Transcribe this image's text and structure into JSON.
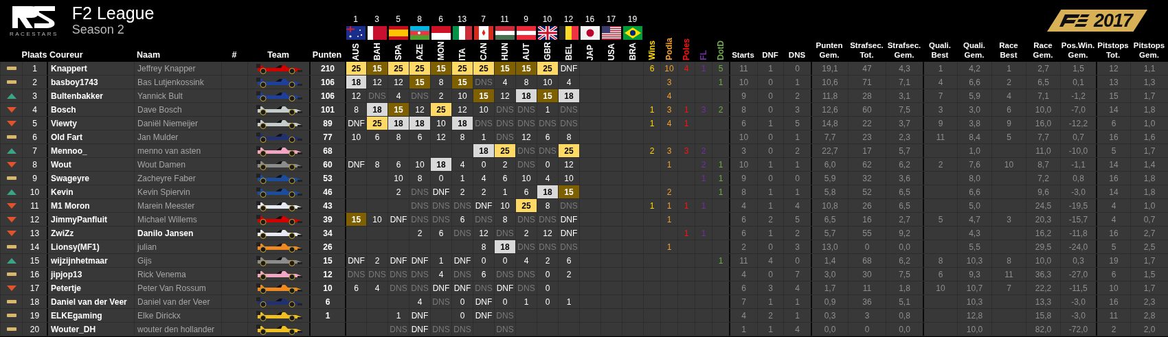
{
  "league": {
    "logo_text": "RACESTARS",
    "title": "F2 League",
    "subtitle": "Season 2",
    "game_year": "2017"
  },
  "columns": [
    "Plaats",
    "Coureur",
    "Naam",
    "#",
    "Team",
    "Punten"
  ],
  "races": [
    {
      "round": "1",
      "code": "AUS"
    },
    {
      "round": "3",
      "code": "BAH"
    },
    {
      "round": "5",
      "code": "SPA"
    },
    {
      "round": "8",
      "code": "AZE"
    },
    {
      "round": "6",
      "code": "MON"
    },
    {
      "round": "13",
      "code": "ITA"
    },
    {
      "round": "7",
      "code": "CAN"
    },
    {
      "round": "11",
      "code": "HUN"
    },
    {
      "round": "9",
      "code": "AUT"
    },
    {
      "round": "10",
      "code": "GBR"
    },
    {
      "round": "12",
      "code": "BEL"
    },
    {
      "round": "16",
      "code": "JAP"
    },
    {
      "round": "17",
      "code": "USA"
    },
    {
      "round": "19",
      "code": "BRA"
    }
  ],
  "stat_columns": [
    {
      "label": "Wins",
      "color": "#ffd800"
    },
    {
      "label": "Podia",
      "color": "#f0a030"
    },
    {
      "label": "Poles",
      "color": "#ff1010"
    },
    {
      "label": "FL",
      "color": "#7030a0"
    },
    {
      "label": "DotD",
      "color": "#70ad47"
    }
  ],
  "summary_columns": [
    "Starts",
    "DNF",
    "DNS",
    "Punten\nGem.",
    "Strafsec.\nTot.",
    "Strafsec.\nGem.",
    "Quali.\nBest",
    "Quali.\nGem.",
    "Race\nBest",
    "Race\nGem.",
    "Pos.Win.\nGem.",
    "Pitstops\nTot.",
    "Pitstops\nGem."
  ],
  "rows": [
    {
      "moved_up": false,
      "moved_down": false,
      "place": "1",
      "driver": "Knappert",
      "name": "Jeffrey Knapper",
      "name_bold": false,
      "team": {
        "color": "#d40000"
      },
      "points": "210",
      "results": [
        {
          "t": "25",
          "kind": "first"
        },
        {
          "t": "15",
          "kind": "third"
        },
        {
          "t": "25",
          "kind": "first"
        },
        {
          "t": "25",
          "kind": "first"
        },
        {
          "t": "15",
          "kind": "third"
        },
        {
          "t": "25",
          "kind": "first"
        },
        {
          "t": "25",
          "kind": "first"
        },
        {
          "t": "15",
          "kind": "third"
        },
        {
          "t": "15",
          "kind": "third"
        },
        {
          "t": "25",
          "kind": "first"
        },
        {
          "t": "DNF",
          "kind": "plain"
        },
        {
          "kind": "empty"
        },
        {
          "kind": "empty"
        },
        {
          "kind": "empty"
        }
      ],
      "wins": "6",
      "podia": "10",
      "poles": "4",
      "fl": "1",
      "dotd": "5",
      "starts": "11",
      "dnf": "1",
      "dns": "0",
      "points_avg": "19,1",
      "penalty_total": "47",
      "penalty_avg": "4,3",
      "quali_best": "1",
      "quali_avg": "4,2",
      "race_best": "1",
      "race_avg": "2,7",
      "pos_gain_avg": "1,5",
      "pitstops_total": "12",
      "pitstops_avg": "1,1"
    },
    {
      "moved_up": false,
      "moved_down": false,
      "place": "2",
      "driver": "basboy1743",
      "name": "Bas Lutjenkossink",
      "name_bold": false,
      "team": {
        "color": "#1d3f9e"
      },
      "points": "106",
      "results": [
        {
          "t": "18",
          "kind": "second"
        },
        {
          "t": "12",
          "kind": "plain"
        },
        {
          "t": "12",
          "kind": "plain"
        },
        {
          "t": "15",
          "kind": "third"
        },
        {
          "t": "8",
          "kind": "plain"
        },
        {
          "t": "15",
          "kind": "third"
        },
        {
          "t": "DNS",
          "kind": "dns"
        },
        {
          "t": "4",
          "kind": "plain"
        },
        {
          "t": "8",
          "kind": "plain"
        },
        {
          "t": "10",
          "kind": "plain"
        },
        {
          "t": "4",
          "kind": "plain"
        },
        {
          "kind": "empty"
        },
        {
          "kind": "empty"
        },
        {
          "kind": "empty"
        }
      ],
      "podia": "3",
      "dotd": "1",
      "starts": "10",
      "dnf": "0",
      "dns": "1",
      "points_avg": "10,6",
      "penalty_total": "71",
      "penalty_avg": "7,1",
      "quali_best": "4",
      "quali_avg": "6,6",
      "race_best": "2",
      "race_avg": "6,5",
      "pos_gain_avg": "0,1",
      "pitstops_total": "13",
      "pitstops_avg": "1,3"
    },
    {
      "moved_up": true,
      "moved_down": false,
      "place": "3",
      "driver": "Bultenbakker",
      "name": "Yannick Bult",
      "name_bold": false,
      "team": {
        "color": "#1d3f9e"
      },
      "points": "106",
      "results": [
        {
          "t": "12",
          "kind": "plain"
        },
        {
          "t": "DNS",
          "kind": "dns"
        },
        {
          "t": "4",
          "kind": "plain"
        },
        {
          "t": "DNS",
          "kind": "dns"
        },
        {
          "t": "2",
          "kind": "plain"
        },
        {
          "t": "10",
          "kind": "plain"
        },
        {
          "t": "15",
          "kind": "third"
        },
        {
          "t": "12",
          "kind": "plain"
        },
        {
          "t": "18",
          "kind": "second"
        },
        {
          "t": "15",
          "kind": "third"
        },
        {
          "t": "18",
          "kind": "second"
        },
        {
          "kind": "empty"
        },
        {
          "kind": "empty"
        },
        {
          "kind": "empty"
        }
      ],
      "podia": "4",
      "starts": "9",
      "dnf": "0",
      "dns": "2",
      "points_avg": "11,8",
      "penalty_total": "28",
      "penalty_avg": "3,1",
      "quali_best": "7",
      "quali_avg": "5,9",
      "race_best": "4",
      "race_avg": "7,1",
      "pos_gain_avg": "-1,2",
      "pitstops_total": "15",
      "pitstops_avg": "1,7"
    },
    {
      "moved_up": false,
      "moved_down": true,
      "place": "4",
      "driver": "Bosch",
      "name": "Dave Bosch",
      "name_bold": false,
      "team": {
        "color": "#c4cccc"
      },
      "points": "101",
      "results": [
        {
          "t": "8",
          "kind": "plain"
        },
        {
          "t": "18",
          "kind": "second"
        },
        {
          "t": "15",
          "kind": "third"
        },
        {
          "t": "12",
          "kind": "plain"
        },
        {
          "t": "25",
          "kind": "first"
        },
        {
          "t": "12",
          "kind": "plain"
        },
        {
          "t": "10",
          "kind": "plain"
        },
        {
          "t": "DNS",
          "kind": "dns"
        },
        {
          "t": "DNS",
          "kind": "dns"
        },
        {
          "t": "1",
          "kind": "plain"
        },
        {
          "t": "DNS",
          "kind": "dns"
        },
        {
          "kind": "empty"
        },
        {
          "kind": "empty"
        },
        {
          "kind": "empty"
        }
      ],
      "wins": "1",
      "podia": "3",
      "poles": "1",
      "fl": "3",
      "dotd": "2",
      "starts": "8",
      "dnf": "0",
      "dns": "3",
      "points_avg": "12,6",
      "penalty_total": "60",
      "penalty_avg": "7,5",
      "quali_best": "3",
      "quali_avg": "3,0",
      "race_best": "6",
      "race_avg": "10,0",
      "pos_gain_avg": "-7,0",
      "pitstops_total": "14",
      "pitstops_avg": "1,8"
    },
    {
      "moved_up": false,
      "moved_down": true,
      "place": "5",
      "driver": "Viewty",
      "name": "Daniël Niemeijer",
      "name_bold": false,
      "team": {
        "color": "#c4cccc"
      },
      "points": "89",
      "results": [
        {
          "t": "DNF",
          "kind": "plain"
        },
        {
          "t": "25",
          "kind": "first"
        },
        {
          "t": "18",
          "kind": "second"
        },
        {
          "t": "18",
          "kind": "second"
        },
        {
          "t": "10",
          "kind": "plain"
        },
        {
          "t": "18",
          "kind": "second"
        },
        {
          "t": "DNS",
          "kind": "dns"
        },
        {
          "t": "DNS",
          "kind": "dns"
        },
        {
          "t": "DNS",
          "kind": "dns"
        },
        {
          "t": "DNS",
          "kind": "dns"
        },
        {
          "t": "DNS",
          "kind": "dns"
        },
        {
          "kind": "empty"
        },
        {
          "kind": "empty"
        },
        {
          "kind": "empty"
        }
      ],
      "wins": "1",
      "podia": "4",
      "poles": "1",
      "starts": "6",
      "dnf": "1",
      "dns": "5",
      "points_avg": "14,8",
      "penalty_total": "22",
      "penalty_avg": "3,7",
      "quali_best": "9",
      "quali_avg": "3,8",
      "race_best": "9",
      "race_avg": "16,0",
      "pos_gain_avg": "-12,2",
      "pitstops_total": "6",
      "pitstops_avg": "1,0"
    },
    {
      "moved_up": false,
      "moved_down": false,
      "place": "6",
      "driver": "Old Fart",
      "name": "Jan Mulder",
      "name_bold": false,
      "team": {
        "color": "#223070"
      },
      "points": "77",
      "results": [
        {
          "t": "10",
          "kind": "plain"
        },
        {
          "t": "6",
          "kind": "plain"
        },
        {
          "t": "8",
          "kind": "plain"
        },
        {
          "t": "6",
          "kind": "plain"
        },
        {
          "t": "12",
          "kind": "plain"
        },
        {
          "t": "8",
          "kind": "plain"
        },
        {
          "t": "1",
          "kind": "plain"
        },
        {
          "t": "DNS",
          "kind": "dns"
        },
        {
          "t": "12",
          "kind": "plain"
        },
        {
          "t": "6",
          "kind": "plain"
        },
        {
          "t": "8",
          "kind": "plain"
        },
        {
          "kind": "empty"
        },
        {
          "kind": "empty"
        },
        {
          "kind": "empty"
        }
      ],
      "starts": "10",
      "dnf": "0",
      "dns": "1",
      "points_avg": "7,7",
      "penalty_total": "23",
      "penalty_avg": "2,3",
      "quali_best": "11",
      "quali_avg": "8,4",
      "race_best": "5",
      "race_avg": "7,7",
      "pos_gain_avg": "0,7",
      "pitstops_total": "16",
      "pitstops_avg": "1,6"
    },
    {
      "moved_up": true,
      "moved_down": false,
      "place": "7",
      "driver": "Mennoo_",
      "name": "menno van asten",
      "name_bold": false,
      "team": {
        "color": "#f2a6c4"
      },
      "points": "68",
      "results": [
        {
          "kind": "empty"
        },
        {
          "kind": "empty"
        },
        {
          "kind": "empty"
        },
        {
          "kind": "empty"
        },
        {
          "kind": "empty"
        },
        {
          "kind": "empty"
        },
        {
          "t": "18",
          "kind": "second"
        },
        {
          "t": "25",
          "kind": "first"
        },
        {
          "t": "DNS",
          "kind": "dns"
        },
        {
          "t": "DNS",
          "kind": "dns"
        },
        {
          "t": "25",
          "kind": "first"
        },
        {
          "kind": "empty"
        },
        {
          "kind": "empty"
        },
        {
          "kind": "empty"
        }
      ],
      "wins": "2",
      "podia": "3",
      "poles": "3",
      "fl": "2",
      "starts": "3",
      "dnf": "0",
      "dns": "2",
      "points_avg": "22,7",
      "penalty_total": "17",
      "penalty_avg": "5,7",
      "quali_avg": "1,0",
      "race_avg": "11,0",
      "pos_gain_avg": "-10,0",
      "pitstops_total": "5",
      "pitstops_avg": "1,7"
    },
    {
      "moved_up": false,
      "moved_down": true,
      "place": "8",
      "driver": "Wout",
      "name": "Wout Damen",
      "name_bold": false,
      "team": {
        "color": "#8c8c8c"
      },
      "points": "60",
      "results": [
        {
          "t": "DNF",
          "kind": "plain"
        },
        {
          "t": "8",
          "kind": "plain"
        },
        {
          "t": "6",
          "kind": "plain"
        },
        {
          "t": "10",
          "kind": "plain"
        },
        {
          "t": "18",
          "kind": "second"
        },
        {
          "t": "4",
          "kind": "plain"
        },
        {
          "t": "0",
          "kind": "plain"
        },
        {
          "t": "2",
          "kind": "plain"
        },
        {
          "t": "DNS",
          "kind": "dns"
        },
        {
          "t": "0",
          "kind": "plain"
        },
        {
          "t": "12",
          "kind": "plain"
        },
        {
          "kind": "empty"
        },
        {
          "kind": "empty"
        },
        {
          "kind": "empty"
        }
      ],
      "podia": "1",
      "fl": "2",
      "dotd": "1",
      "starts": "10",
      "dnf": "1",
      "dns": "1",
      "points_avg": "6,0",
      "penalty_total": "62",
      "penalty_avg": "6,2",
      "quali_best": "2",
      "quali_avg": "7,6",
      "race_best": "10",
      "race_avg": "8,7",
      "pos_gain_avg": "-1,1",
      "pitstops_total": "14",
      "pitstops_avg": "1,4"
    },
    {
      "moved_up": false,
      "moved_down": false,
      "place": "9",
      "driver": "Swageyre",
      "name": "Zacheyre Faber",
      "name_bold": false,
      "team": {
        "color": "#1c4c9c"
      },
      "points": "53",
      "results": [
        {
          "kind": "empty"
        },
        {
          "kind": "empty"
        },
        {
          "t": "10",
          "kind": "plain"
        },
        {
          "t": "8",
          "kind": "plain"
        },
        {
          "t": "0",
          "kind": "plain"
        },
        {
          "t": "1",
          "kind": "plain"
        },
        {
          "t": "4",
          "kind": "plain"
        },
        {
          "t": "6",
          "kind": "plain"
        },
        {
          "t": "10",
          "kind": "plain"
        },
        {
          "t": "4",
          "kind": "plain"
        },
        {
          "t": "10",
          "kind": "plain"
        },
        {
          "kind": "empty"
        },
        {
          "kind": "empty"
        },
        {
          "kind": "empty"
        }
      ],
      "fl": "1",
      "dotd": "1",
      "starts": "9",
      "dnf": "0",
      "dns": "0",
      "points_avg": "5,9",
      "penalty_total": "32",
      "penalty_avg": "3,6",
      "quali_avg": "8,0",
      "race_avg": "7,2",
      "pos_gain_avg": "0,8",
      "pitstops_total": "16",
      "pitstops_avg": "1,8"
    },
    {
      "moved_up": true,
      "moved_down": false,
      "place": "10",
      "driver": "Kevin",
      "name": "Kevin Spiervin",
      "name_bold": false,
      "team": {
        "color": "#1c4c9c"
      },
      "points": "46",
      "results": [
        {
          "kind": "empty"
        },
        {
          "kind": "empty"
        },
        {
          "t": "2",
          "kind": "plain"
        },
        {
          "t": "DNS",
          "kind": "dns"
        },
        {
          "t": "DNF",
          "kind": "plain"
        },
        {
          "t": "2",
          "kind": "plain"
        },
        {
          "t": "2",
          "kind": "plain"
        },
        {
          "t": "1",
          "kind": "plain"
        },
        {
          "t": "6",
          "kind": "plain"
        },
        {
          "t": "18",
          "kind": "second"
        },
        {
          "t": "15",
          "kind": "third"
        },
        {
          "kind": "empty"
        },
        {
          "kind": "empty"
        },
        {
          "kind": "empty"
        }
      ],
      "podia": "2",
      "dotd": "1",
      "starts": "8",
      "dnf": "1",
      "dns": "1",
      "points_avg": "5,8",
      "penalty_total": "52",
      "penalty_avg": "6,5",
      "quali_avg": "6,6",
      "race_avg": "9,6",
      "pos_gain_avg": "-3,0",
      "pitstops_total": "14",
      "pitstops_avg": "1,8"
    },
    {
      "moved_up": false,
      "moved_down": true,
      "place": "11",
      "driver": "M1 Moron",
      "name": "Marein Meester",
      "name_bold": false,
      "team": {
        "color": "#e6e8f2"
      },
      "points": "43",
      "results": [
        {
          "kind": "empty"
        },
        {
          "kind": "empty"
        },
        {
          "kind": "empty"
        },
        {
          "t": "DNS",
          "kind": "dns"
        },
        {
          "t": "DNS",
          "kind": "dns"
        },
        {
          "t": "DNS",
          "kind": "dns"
        },
        {
          "t": "DNF",
          "kind": "plain"
        },
        {
          "t": "10",
          "kind": "plain"
        },
        {
          "t": "25",
          "kind": "first"
        },
        {
          "t": "8",
          "kind": "plain"
        },
        {
          "t": "DNS",
          "kind": "dns"
        },
        {
          "kind": "empty"
        },
        {
          "kind": "empty"
        },
        {
          "kind": "empty"
        }
      ],
      "wins": "1",
      "podia": "1",
      "poles": "1",
      "fl": "1",
      "starts": "4",
      "dnf": "1",
      "dns": "4",
      "points_avg": "10,8",
      "penalty_total": "26",
      "penalty_avg": "6,5",
      "quali_avg": "5,0",
      "race_avg": "24,5",
      "pos_gain_avg": "-19,5",
      "pitstops_total": "4",
      "pitstops_avg": "1,0"
    },
    {
      "moved_up": false,
      "moved_down": true,
      "place": "12",
      "driver": "JimmyPanfluit",
      "name": "Michael Willems",
      "name_bold": false,
      "team": {
        "color": "#d40000"
      },
      "points": "39",
      "results": [
        {
          "t": "15",
          "kind": "third"
        },
        {
          "t": "10",
          "kind": "plain"
        },
        {
          "t": "DNF",
          "kind": "plain"
        },
        {
          "t": "DNS",
          "kind": "dns"
        },
        {
          "t": "DNS",
          "kind": "dns"
        },
        {
          "t": "6",
          "kind": "plain"
        },
        {
          "t": "DNS",
          "kind": "dns"
        },
        {
          "t": "8",
          "kind": "plain"
        },
        {
          "t": "DNS",
          "kind": "dns"
        },
        {
          "t": "DNS",
          "kind": "dns"
        },
        {
          "t": "DNF",
          "kind": "plain"
        },
        {
          "kind": "empty"
        },
        {
          "kind": "empty"
        },
        {
          "kind": "empty"
        }
      ],
      "podia": "1",
      "starts": "6",
      "dnf": "2",
      "dns": "5",
      "points_avg": "6,5",
      "penalty_total": "16",
      "penalty_avg": "2,7",
      "quali_best": "5",
      "quali_avg": "4,7",
      "race_best": "3",
      "race_avg": "20,3",
      "pos_gain_avg": "-15,7",
      "pitstops_total": "4",
      "pitstops_avg": "0,7"
    },
    {
      "moved_up": false,
      "moved_down": true,
      "place": "13",
      "driver": "ZwiZz",
      "name": "Danilo Jansen",
      "name_bold": true,
      "team": {
        "color": "#e6e8f2"
      },
      "points": "34",
      "results": [
        {
          "kind": "empty"
        },
        {
          "kind": "empty"
        },
        {
          "kind": "empty"
        },
        {
          "t": "2",
          "kind": "plain"
        },
        {
          "t": "6",
          "kind": "plain"
        },
        {
          "t": "DNS",
          "kind": "dns"
        },
        {
          "t": "12",
          "kind": "plain"
        },
        {
          "t": "DNS",
          "kind": "dns"
        },
        {
          "t": "2",
          "kind": "plain"
        },
        {
          "t": "12",
          "kind": "plain"
        },
        {
          "t": "DNF",
          "kind": "plain"
        },
        {
          "kind": "empty"
        },
        {
          "kind": "empty"
        },
        {
          "kind": "empty"
        }
      ],
      "poles": "1",
      "fl": "1",
      "starts": "6",
      "dnf": "1",
      "dns": "2",
      "points_avg": "5,7",
      "penalty_total": "55",
      "penalty_avg": "9,2",
      "quali_avg": "4,3",
      "race_avg": "16,2",
      "pos_gain_avg": "-11,8",
      "pitstops_total": "16",
      "pitstops_avg": "2,7"
    },
    {
      "moved_up": false,
      "moved_down": false,
      "place": "14",
      "driver": "Lionsy(MF1)",
      "name": "julian",
      "name_bold": false,
      "team": {
        "color": "#f08a20"
      },
      "points": "26",
      "results": [
        {
          "kind": "empty"
        },
        {
          "kind": "empty"
        },
        {
          "kind": "empty"
        },
        {
          "kind": "empty"
        },
        {
          "kind": "empty"
        },
        {
          "kind": "empty"
        },
        {
          "t": "8",
          "kind": "plain"
        },
        {
          "t": "18",
          "kind": "second"
        },
        {
          "t": "DNS",
          "kind": "dns"
        },
        {
          "t": "DNS",
          "kind": "dns"
        },
        {
          "t": "DNS",
          "kind": "dns"
        },
        {
          "kind": "empty"
        },
        {
          "kind": "empty"
        },
        {
          "kind": "empty"
        }
      ],
      "podia": "1",
      "starts": "2",
      "dnf": "0",
      "dns": "3",
      "points_avg": "13,0",
      "penalty_total": "0",
      "penalty_avg": "0,0",
      "quali_avg": "5,5",
      "race_avg": "29,5",
      "pos_gain_avg": "-24,0",
      "pitstops_total": "5",
      "pitstops_avg": "2,5"
    },
    {
      "moved_up": true,
      "moved_down": false,
      "place": "15",
      "driver": "wijzijnhetmaar",
      "name": "Gijs",
      "name_bold": false,
      "team": {
        "color": "#8c8c8c"
      },
      "points": "15",
      "results": [
        {
          "t": "DNF",
          "kind": "plain"
        },
        {
          "t": "2",
          "kind": "plain"
        },
        {
          "t": "DNF",
          "kind": "plain"
        },
        {
          "t": "DNF",
          "kind": "plain"
        },
        {
          "t": "1",
          "kind": "plain"
        },
        {
          "t": "DNF",
          "kind": "plain"
        },
        {
          "t": "0",
          "kind": "plain"
        },
        {
          "t": "0",
          "kind": "plain"
        },
        {
          "t": "4",
          "kind": "plain"
        },
        {
          "t": "2",
          "kind": "plain"
        },
        {
          "t": "6",
          "kind": "plain"
        },
        {
          "kind": "empty"
        },
        {
          "kind": "empty"
        },
        {
          "kind": "empty"
        }
      ],
      "dotd": "1",
      "starts": "11",
      "dnf": "4",
      "dns": "0",
      "points_avg": "1,4",
      "penalty_total": "68",
      "penalty_avg": "6,2",
      "quali_best": "8",
      "quali_avg": "10,3",
      "race_best": "8",
      "race_avg": "10,0",
      "pos_gain_avg": "0,3",
      "pitstops_total": "19",
      "pitstops_avg": "1,7"
    },
    {
      "moved_up": false,
      "moved_down": false,
      "place": "16",
      "driver": "jipjop13",
      "name": "Rick Venema",
      "name_bold": false,
      "team": {
        "color": "#f2a6c4"
      },
      "points": "12",
      "results": [
        {
          "t": "DNS",
          "kind": "dns"
        },
        {
          "t": "DNS",
          "kind": "dns"
        },
        {
          "t": "DNS",
          "kind": "dns"
        },
        {
          "t": "DNS",
          "kind": "dns"
        },
        {
          "t": "4",
          "kind": "plain"
        },
        {
          "t": "DNS",
          "kind": "dns"
        },
        {
          "t": "6",
          "kind": "plain"
        },
        {
          "t": "DNS",
          "kind": "dns"
        },
        {
          "t": "DNS",
          "kind": "dns"
        },
        {
          "t": "0",
          "kind": "plain"
        },
        {
          "t": "2",
          "kind": "plain"
        },
        {
          "kind": "empty"
        },
        {
          "kind": "empty"
        },
        {
          "kind": "empty"
        }
      ],
      "starts": "4",
      "dnf": "0",
      "dns": "7",
      "points_avg": "3,0",
      "penalty_total": "30",
      "penalty_avg": "7,5",
      "quali_best": "6",
      "quali_avg": "9,3",
      "race_best": "11",
      "race_avg": "36,3",
      "pos_gain_avg": "-27,0",
      "pitstops_total": "6",
      "pitstops_avg": "1,5"
    },
    {
      "moved_up": false,
      "moved_down": true,
      "place": "17",
      "driver": "Petertje",
      "name": "Peter Van Rossum",
      "name_bold": false,
      "team": {
        "color": "#f08a20"
      },
      "points": "10",
      "results": [
        {
          "t": "6",
          "kind": "plain"
        },
        {
          "t": "4",
          "kind": "plain"
        },
        {
          "t": "DNS",
          "kind": "dns"
        },
        {
          "t": "DNS",
          "kind": "dns"
        },
        {
          "t": "DNF",
          "kind": "plain"
        },
        {
          "t": "DNF",
          "kind": "plain"
        },
        {
          "t": "DNS",
          "kind": "dns"
        },
        {
          "t": "DNF",
          "kind": "plain"
        },
        {
          "t": "DNS",
          "kind": "dns"
        },
        {
          "t": "0",
          "kind": "plain"
        },
        {
          "kind": "empty"
        },
        {
          "kind": "empty"
        },
        {
          "kind": "empty"
        },
        {
          "kind": "empty"
        }
      ],
      "starts": "6",
      "dnf": "3",
      "dns": "4",
      "points_avg": "1,7",
      "penalty_total": "11",
      "penalty_avg": "1,8",
      "quali_best": "10",
      "quali_avg": "10,7",
      "race_best": "7",
      "race_avg": "22,2",
      "pos_gain_avg": "-11,5",
      "pitstops_total": "10",
      "pitstops_avg": "1,7"
    },
    {
      "moved_up": false,
      "moved_down": false,
      "place": "18",
      "driver": "Daniel van der Veer",
      "name": "Daniel van der Veer",
      "name_bold": false,
      "team": {
        "color": "#223070"
      },
      "points": "6",
      "results": [
        {
          "kind": "empty"
        },
        {
          "kind": "empty"
        },
        {
          "kind": "empty"
        },
        {
          "t": "4",
          "kind": "plain"
        },
        {
          "t": "DNS",
          "kind": "dns"
        },
        {
          "t": "0",
          "kind": "plain"
        },
        {
          "t": "DNF",
          "kind": "plain"
        },
        {
          "t": "0",
          "kind": "plain"
        },
        {
          "t": "1",
          "kind": "plain"
        },
        {
          "t": "0",
          "kind": "plain"
        },
        {
          "t": "1",
          "kind": "plain"
        },
        {
          "kind": "empty"
        },
        {
          "kind": "empty"
        },
        {
          "kind": "empty"
        }
      ],
      "starts": "7",
      "dnf": "1",
      "dns": "1",
      "points_avg": "0,9",
      "penalty_total": "36",
      "penalty_avg": "5,1",
      "quali_avg": "10,3",
      "race_avg": "13,3",
      "pos_gain_avg": "-3,0",
      "pitstops_total": "16",
      "pitstops_avg": "2,3"
    },
    {
      "moved_up": false,
      "moved_down": false,
      "place": "19",
      "driver": "ELKEgaming",
      "name": "Elke Dirickx",
      "name_bold": false,
      "team": {
        "color": "#f0c020"
      },
      "points": "1",
      "results": [
        {
          "kind": "empty"
        },
        {
          "kind": "empty"
        },
        {
          "t": "1",
          "kind": "plain"
        },
        {
          "t": "DNF",
          "kind": "plain"
        },
        {
          "kind": "empty"
        },
        {
          "t": "0",
          "kind": "plain"
        },
        {
          "t": "DNF",
          "kind": "plain"
        },
        {
          "t": "DNS",
          "kind": "dns"
        },
        {
          "kind": "empty"
        },
        {
          "kind": "empty"
        },
        {
          "kind": "empty"
        },
        {
          "kind": "empty"
        },
        {
          "kind": "empty"
        },
        {
          "kind": "empty"
        }
      ],
      "starts": "4",
      "dnf": "2",
      "dns": "1",
      "points_avg": "0,3",
      "penalty_total": "3",
      "penalty_avg": "0,8",
      "quali_avg": "12,8",
      "race_avg": "15,8",
      "pos_gain_avg": "-3,0",
      "pitstops_total": "11",
      "pitstops_avg": "2,8"
    },
    {
      "moved_up": false,
      "moved_down": false,
      "place": "20",
      "driver": "Wouter_DH",
      "name": "wouter den hollander",
      "name_bold": false,
      "team": {
        "color": "#f0c020"
      },
      "results": [
        {
          "kind": "empty"
        },
        {
          "kind": "empty"
        },
        {
          "t": "DNS",
          "kind": "dns"
        },
        {
          "t": "DNF",
          "kind": "plain"
        },
        {
          "t": "DNS",
          "kind": "dns"
        },
        {
          "t": "DNS",
          "kind": "dns"
        },
        {
          "kind": "empty"
        },
        {
          "t": "DNS",
          "kind": "dns"
        },
        {
          "kind": "empty"
        },
        {
          "kind": "empty"
        },
        {
          "kind": "empty"
        },
        {
          "kind": "empty"
        },
        {
          "kind": "empty"
        },
        {
          "kind": "empty"
        }
      ],
      "starts": "1",
      "dnf": "1",
      "dns": "4",
      "points_avg": "0,0",
      "penalty_total": "0",
      "penalty_avg": "0,0",
      "quali_avg": "10,0",
      "race_avg": "82,0",
      "pos_gain_avg": "-72,0",
      "pitstops_total": "2",
      "pitstops_avg": "2,0"
    }
  ]
}
